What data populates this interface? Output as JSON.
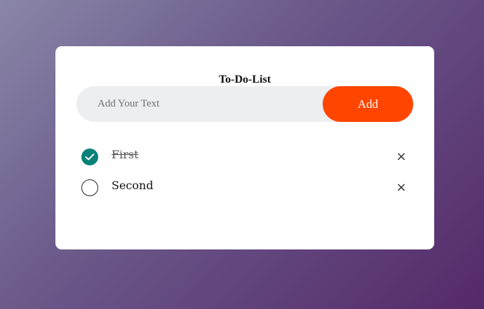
{
  "app": {
    "title": "To-Do-List"
  },
  "input": {
    "placeholder": "Add Your Text",
    "value": ""
  },
  "add_button": {
    "label": "Add",
    "color": "#ff4500"
  },
  "todos": [
    {
      "text": "First",
      "completed": true,
      "remove_label": "×"
    },
    {
      "text": "Second",
      "completed": false,
      "remove_label": "×"
    }
  ],
  "colors": {
    "checked": "#088178",
    "card": "#ffffff"
  }
}
